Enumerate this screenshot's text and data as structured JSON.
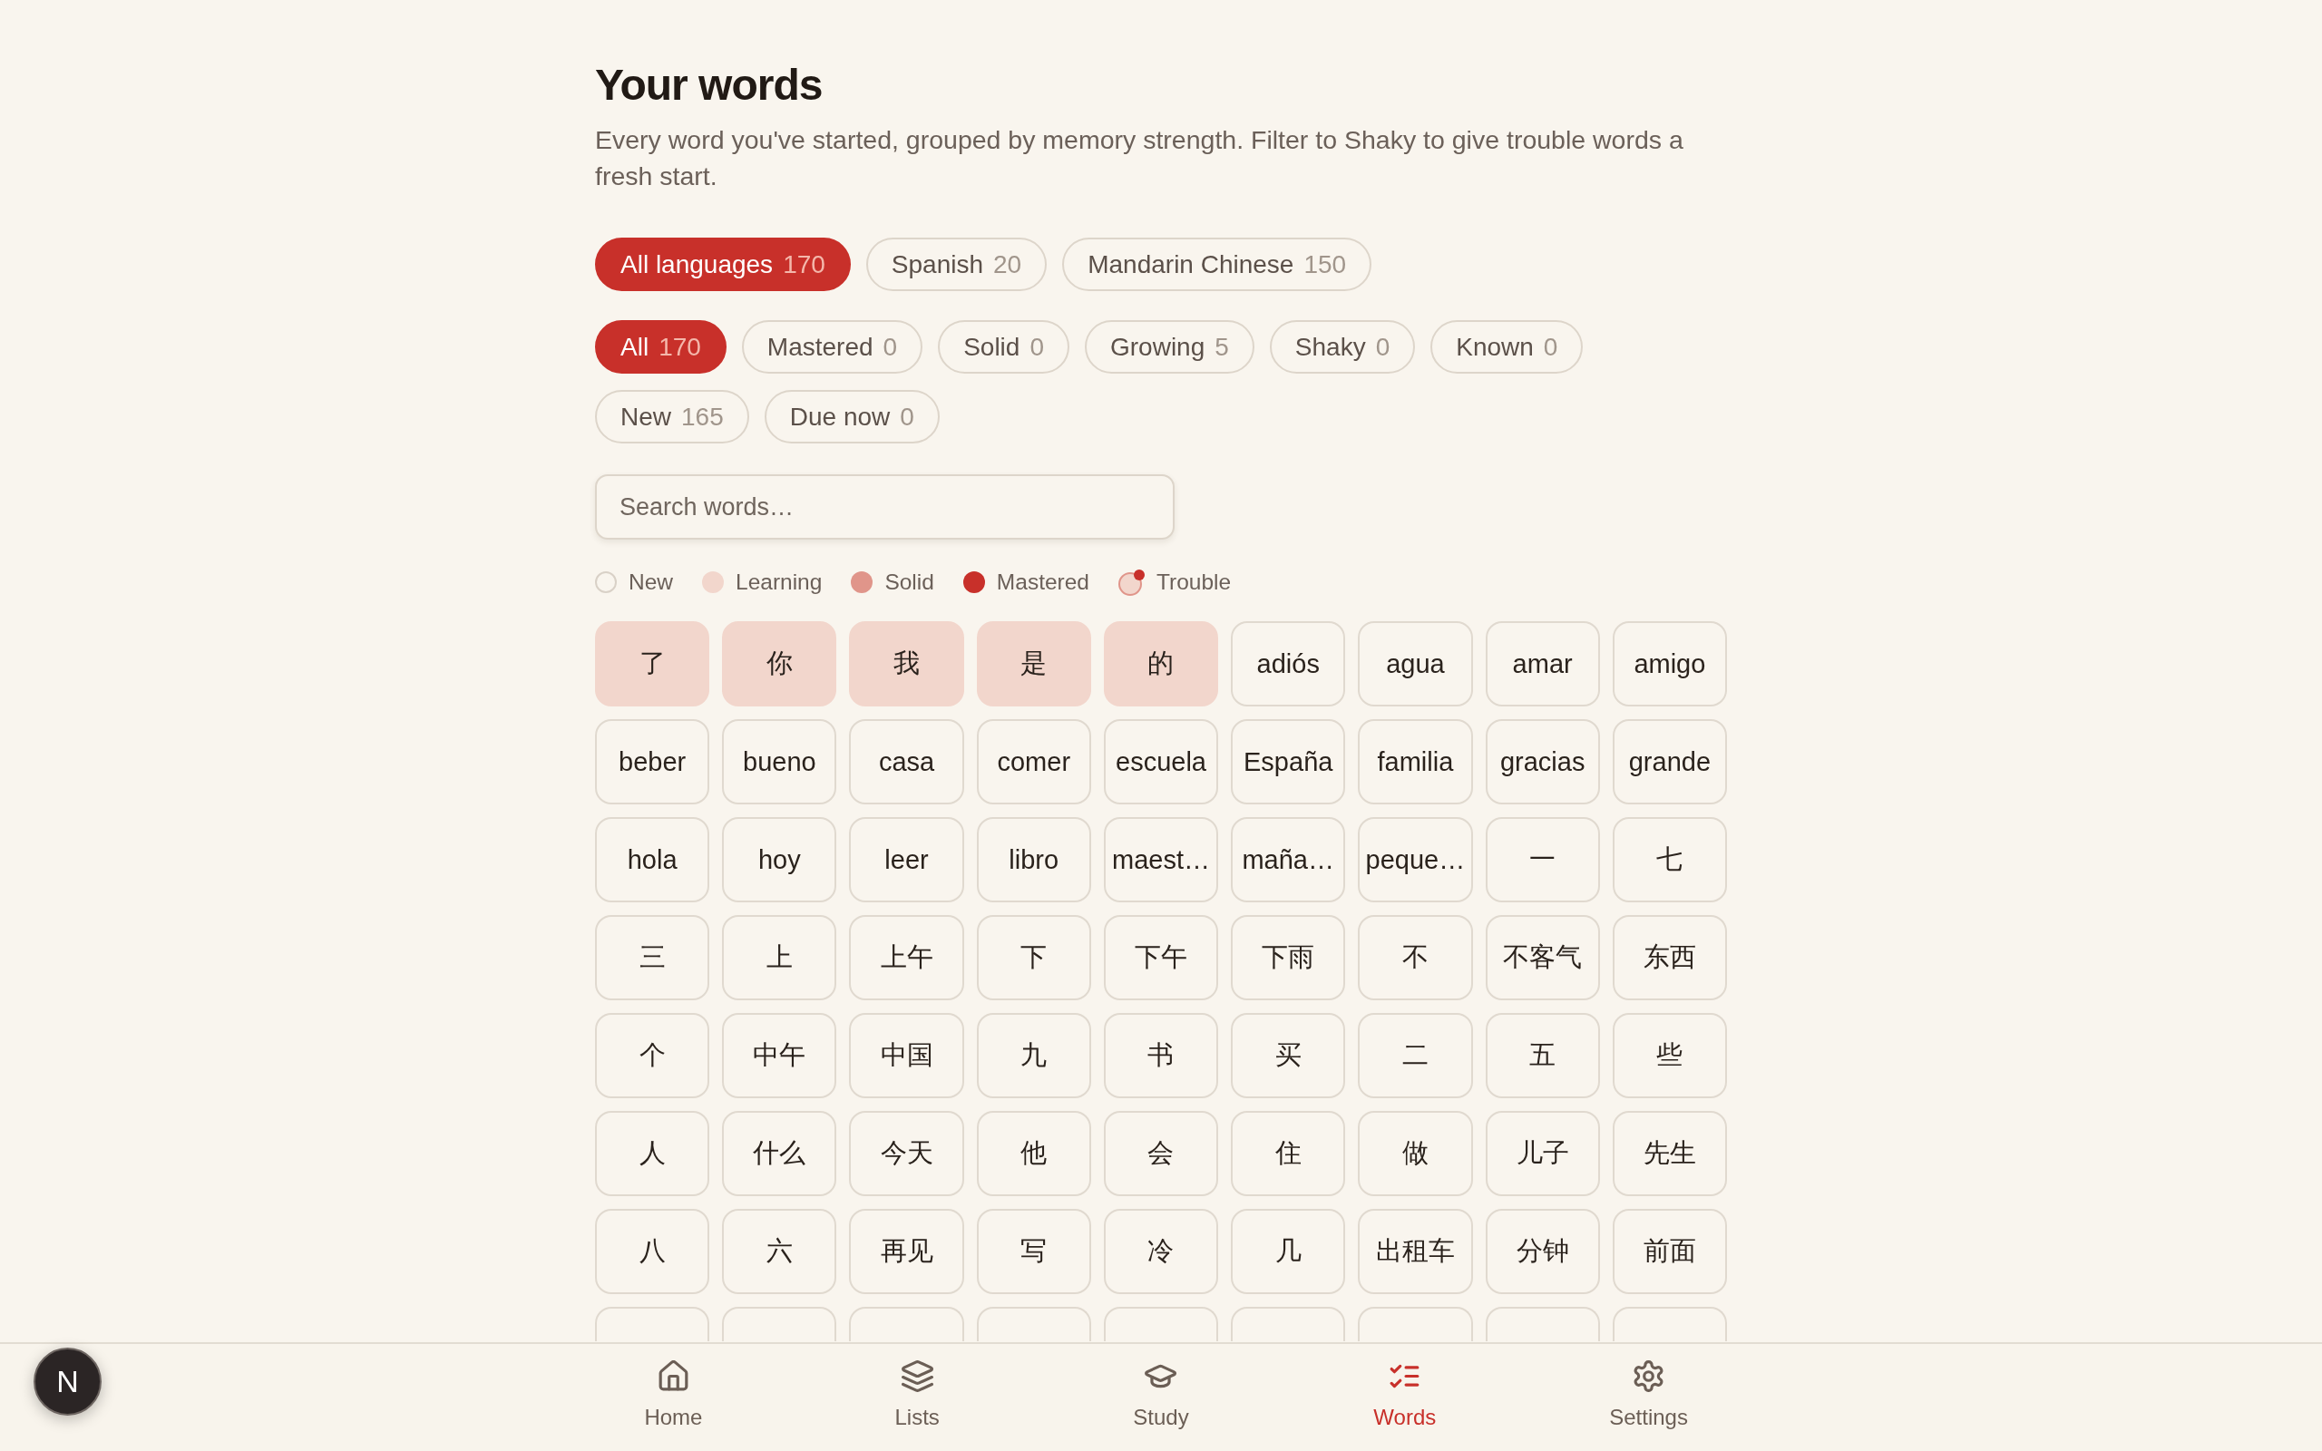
{
  "page": {
    "title": "Your words",
    "description": "Every word you've started, grouped by memory strength. Filter to Shaky to give trouble words a fresh start."
  },
  "language_filters": [
    {
      "label": "All languages",
      "count": "170",
      "selected": true
    },
    {
      "label": "Spanish",
      "count": "20",
      "selected": false
    },
    {
      "label": "Mandarin Chinese",
      "count": "150",
      "selected": false
    }
  ],
  "strength_filters": [
    {
      "label": "All",
      "count": "170",
      "selected": true
    },
    {
      "label": "Mastered",
      "count": "0",
      "selected": false
    },
    {
      "label": "Solid",
      "count": "0",
      "selected": false
    },
    {
      "label": "Growing",
      "count": "5",
      "selected": false
    },
    {
      "label": "Shaky",
      "count": "0",
      "selected": false
    },
    {
      "label": "Known",
      "count": "0",
      "selected": false
    },
    {
      "label": "New",
      "count": "165",
      "selected": false
    },
    {
      "label": "Due now",
      "count": "0",
      "selected": false
    }
  ],
  "search": {
    "placeholder": "Search words…"
  },
  "legend": [
    {
      "kind": "new",
      "label": "New"
    },
    {
      "kind": "learning",
      "label": "Learning"
    },
    {
      "kind": "solid",
      "label": "Solid"
    },
    {
      "kind": "mastered",
      "label": "Mastered"
    },
    {
      "kind": "trouble",
      "label": "Trouble"
    }
  ],
  "words": [
    {
      "word": "了",
      "kind": "learning"
    },
    {
      "word": "你",
      "kind": "learning"
    },
    {
      "word": "我",
      "kind": "learning"
    },
    {
      "word": "是",
      "kind": "learning"
    },
    {
      "word": "的",
      "kind": "learning"
    },
    {
      "word": "adiós",
      "kind": "new"
    },
    {
      "word": "agua",
      "kind": "new"
    },
    {
      "word": "amar",
      "kind": "new"
    },
    {
      "word": "amigo",
      "kind": "new"
    },
    {
      "word": "beber",
      "kind": "new"
    },
    {
      "word": "bueno",
      "kind": "new"
    },
    {
      "word": "casa",
      "kind": "new"
    },
    {
      "word": "comer",
      "kind": "new"
    },
    {
      "word": "escuela",
      "kind": "new"
    },
    {
      "word": "España",
      "kind": "new"
    },
    {
      "word": "familia",
      "kind": "new"
    },
    {
      "word": "gracias",
      "kind": "new"
    },
    {
      "word": "grande",
      "kind": "new"
    },
    {
      "word": "hola",
      "kind": "new"
    },
    {
      "word": "hoy",
      "kind": "new"
    },
    {
      "word": "leer",
      "kind": "new"
    },
    {
      "word": "libro",
      "kind": "new"
    },
    {
      "word": "maest…",
      "kind": "new"
    },
    {
      "word": "maña…",
      "kind": "new"
    },
    {
      "word": "peque…",
      "kind": "new"
    },
    {
      "word": "一",
      "kind": "new"
    },
    {
      "word": "七",
      "kind": "new"
    },
    {
      "word": "三",
      "kind": "new"
    },
    {
      "word": "上",
      "kind": "new"
    },
    {
      "word": "上午",
      "kind": "new"
    },
    {
      "word": "下",
      "kind": "new"
    },
    {
      "word": "下午",
      "kind": "new"
    },
    {
      "word": "下雨",
      "kind": "new"
    },
    {
      "word": "不",
      "kind": "new"
    },
    {
      "word": "不客气",
      "kind": "new"
    },
    {
      "word": "东西",
      "kind": "new"
    },
    {
      "word": "个",
      "kind": "new"
    },
    {
      "word": "中午",
      "kind": "new"
    },
    {
      "word": "中国",
      "kind": "new"
    },
    {
      "word": "九",
      "kind": "new"
    },
    {
      "word": "书",
      "kind": "new"
    },
    {
      "word": "买",
      "kind": "new"
    },
    {
      "word": "二",
      "kind": "new"
    },
    {
      "word": "五",
      "kind": "new"
    },
    {
      "word": "些",
      "kind": "new"
    },
    {
      "word": "人",
      "kind": "new"
    },
    {
      "word": "什么",
      "kind": "new"
    },
    {
      "word": "今天",
      "kind": "new"
    },
    {
      "word": "他",
      "kind": "new"
    },
    {
      "word": "会",
      "kind": "new"
    },
    {
      "word": "住",
      "kind": "new"
    },
    {
      "word": "做",
      "kind": "new"
    },
    {
      "word": "儿子",
      "kind": "new"
    },
    {
      "word": "先生",
      "kind": "new"
    },
    {
      "word": "八",
      "kind": "new"
    },
    {
      "word": "六",
      "kind": "new"
    },
    {
      "word": "再见",
      "kind": "new"
    },
    {
      "word": "写",
      "kind": "new"
    },
    {
      "word": "冷",
      "kind": "new"
    },
    {
      "word": "几",
      "kind": "new"
    },
    {
      "word": "出租车",
      "kind": "new"
    },
    {
      "word": "分钟",
      "kind": "new"
    },
    {
      "word": "前面",
      "kind": "new"
    },
    {
      "kind": "new"
    },
    {
      "kind": "new"
    },
    {
      "kind": "new"
    },
    {
      "kind": "new"
    },
    {
      "kind": "new"
    },
    {
      "kind": "new"
    },
    {
      "kind": "new"
    },
    {
      "kind": "new"
    },
    {
      "kind": "new"
    }
  ],
  "nav": [
    {
      "label": "Home",
      "selected": false
    },
    {
      "label": "Lists",
      "selected": false
    },
    {
      "label": "Study",
      "selected": false
    },
    {
      "label": "Words",
      "selected": true
    },
    {
      "label": "Settings",
      "selected": false
    }
  ],
  "dev_badge": {
    "label": "N"
  }
}
